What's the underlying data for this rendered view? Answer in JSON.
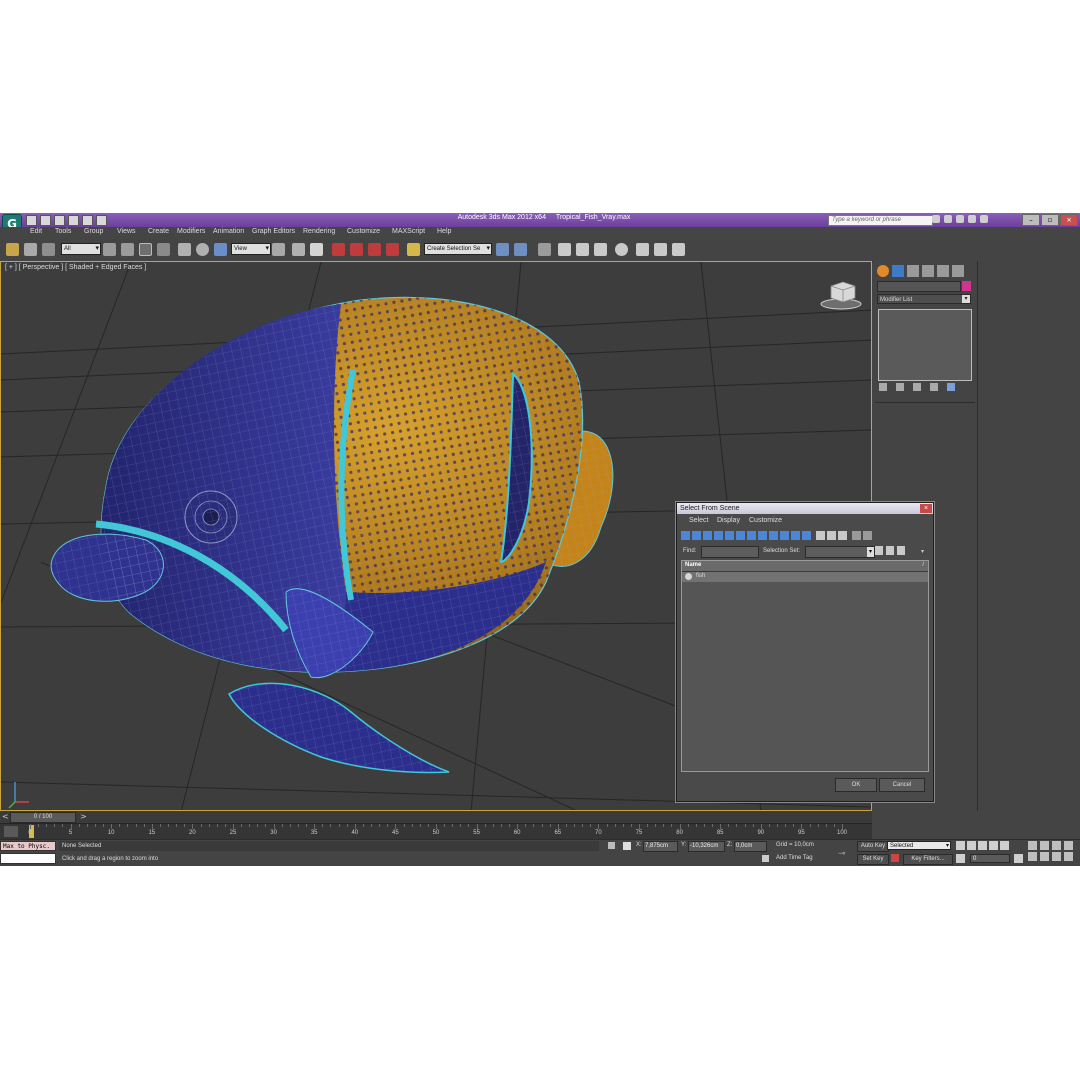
{
  "window": {
    "app_title": "Autodesk 3ds Max  2012 x64",
    "file_title": "Tropical_Fish_Vray.max",
    "search_placeholder": "Type a keyword or phrase"
  },
  "menu": [
    "Edit",
    "Tools",
    "Group",
    "Views",
    "Create",
    "Modifiers",
    "Animation",
    "Graph Editors",
    "Rendering",
    "Customize",
    "MAXScript",
    "Help"
  ],
  "toolbar": {
    "selection_filter": "All",
    "reference_coord": "View",
    "named_selection": "Create Selection Se"
  },
  "viewport": {
    "label": "[ + ] [ Perspective ] [ Shaded + Edged Faces ]"
  },
  "command_panel": {
    "modifier_list": "Modifier List",
    "object_color": "#d0358d"
  },
  "dialog": {
    "title": "Select From Scene",
    "menu": [
      "Select",
      "Display",
      "Customize"
    ],
    "find_label": "Find:",
    "selection_set_label": "Selection Set:",
    "column_name": "Name",
    "sort_arrow": "/",
    "items": [
      "fish"
    ],
    "ok_label": "OK",
    "cancel_label": "Cancel"
  },
  "timeline": {
    "frame_readout": "0 / 100",
    "ticks": [
      "0",
      "5",
      "10",
      "15",
      "20",
      "25",
      "30",
      "35",
      "40",
      "45",
      "50",
      "55",
      "60",
      "65",
      "70",
      "75",
      "80",
      "85",
      "90",
      "95",
      "100"
    ]
  },
  "status": {
    "maxscript_text": "Max to Physc.",
    "selection_text": "None Selected",
    "prompt_text": "Click and drag a region to zoom into",
    "x_label": "X:",
    "x_value": "7,875cm",
    "y_label": "Y:",
    "y_value": "-10,326cm",
    "z_label": "Z:",
    "z_value": "0,0cm",
    "grid_text": "Grid = 10,0cm",
    "add_time_tag": "Add Time Tag",
    "auto_key": "Auto Key",
    "set_key": "Set Key",
    "key_mode_value": "Selected",
    "key_filters": "Key Filters...",
    "frame_value": "0"
  },
  "colors": {
    "title_bar": "#7a4eaa",
    "viewport_border": "#c9a53a",
    "fish_blue": "#2b2e8c",
    "fish_orange": "#c98a1e",
    "fish_cyan": "#3ec8d8",
    "wireframe": "#9aa6c8"
  }
}
